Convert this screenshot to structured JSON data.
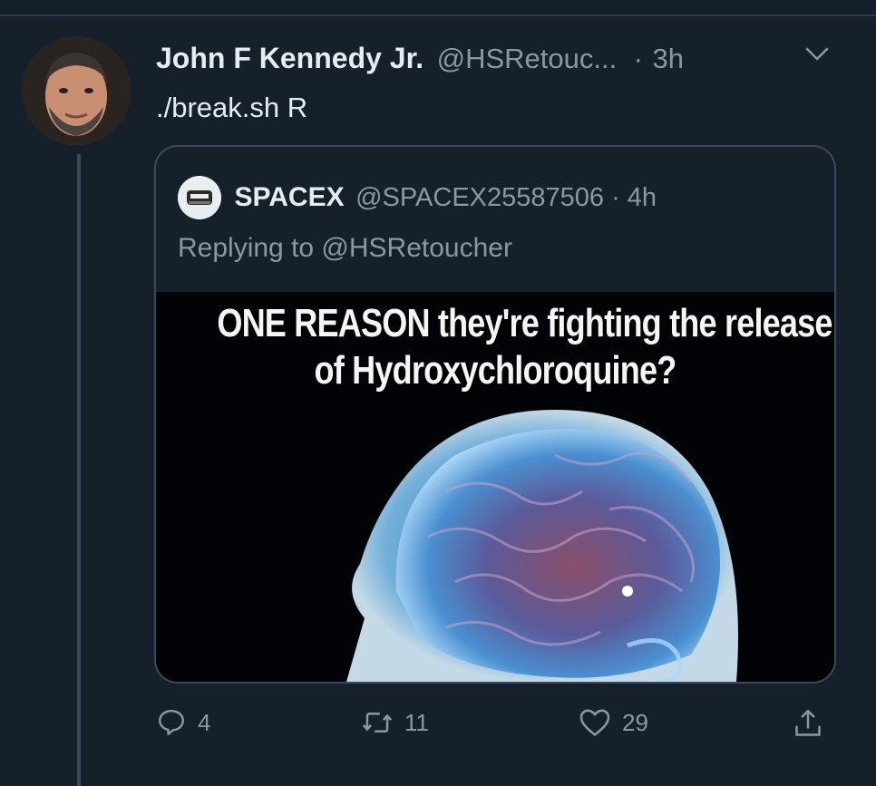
{
  "tweet": {
    "author_name": "John F Kennedy Jr.",
    "handle": "@HSRetouc...",
    "separator": "·",
    "time": "3h",
    "text": "./break.sh R"
  },
  "quoted_tweet": {
    "author_name": "SPACEX",
    "handle_time": "@SPACEX25587506 · 4h",
    "reply_line": "Replying to @HSRetoucher",
    "image_text_line1": "ONE REASON they're fighting the release",
    "image_text_line2": "of Hydroxychloroquine?"
  },
  "actions": {
    "replies": "4",
    "retweets": "11",
    "likes": "29"
  },
  "icons": {
    "menu": "chevron-down-icon",
    "reply": "reply-bubble-icon",
    "retweet": "retweet-icon",
    "like": "heart-icon",
    "share": "share-icon"
  },
  "colors": {
    "background": "#15202b",
    "secondary_text": "#8899a6",
    "border": "#3a4a5b"
  }
}
